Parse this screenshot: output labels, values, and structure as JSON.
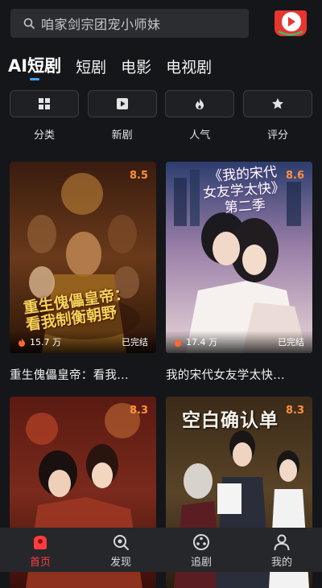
{
  "search": {
    "placeholder": "咱家剑宗团宠小师妹"
  },
  "tabs": [
    {
      "label": "AI短剧",
      "active": true
    },
    {
      "label": "短剧"
    },
    {
      "label": "电影"
    },
    {
      "label": "电视剧"
    }
  ],
  "categories": [
    {
      "label": "分类",
      "icon": "grid-icon"
    },
    {
      "label": "新剧",
      "icon": "play-icon"
    },
    {
      "label": "人气",
      "icon": "flame-icon"
    },
    {
      "label": "评分",
      "icon": "star-icon"
    }
  ],
  "cards": [
    {
      "title": "重生傀儡皇帝：看我...",
      "score": "8.5",
      "views": "15.7 万",
      "status": "已完结",
      "poster_text": "重生傀儡皇帝：\n看我制衡朝野"
    },
    {
      "title": "我的宋代女友学太快...",
      "score": "8.6",
      "views": "17.4 万",
      "status": "已完结",
      "poster_text": "《我的宋代\n女友学太快》\n第二季"
    },
    {
      "title": "",
      "score": "8.3",
      "views": "",
      "status": ""
    },
    {
      "title": "",
      "score": "8.3",
      "views": "",
      "status": "",
      "poster_text": "空白确认单"
    }
  ],
  "nav": [
    {
      "label": "首页",
      "icon": "home-icon",
      "active": true
    },
    {
      "label": "发现",
      "icon": "discover-icon"
    },
    {
      "label": "追剧",
      "icon": "follow-icon"
    },
    {
      "label": "我的",
      "icon": "profile-icon"
    }
  ],
  "colors": {
    "accent": "#ff3d3d",
    "tab_indicator": "#45a4ff",
    "score": "#ff8f3d",
    "background": "#151619"
  }
}
